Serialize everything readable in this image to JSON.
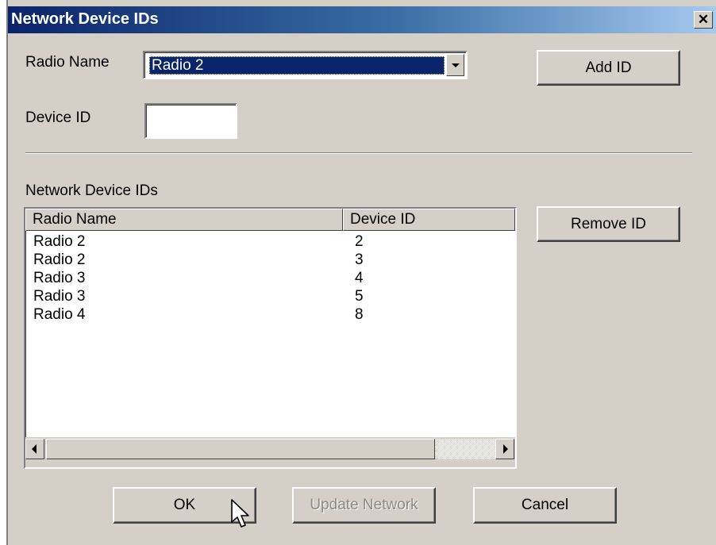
{
  "window": {
    "title": "Network Device IDs",
    "close_glyph": "✕"
  },
  "form": {
    "radio_name_label": "Radio Name",
    "radio_name_value": "Radio 2",
    "device_id_label": "Device ID",
    "device_id_value": "",
    "add_button": "Add ID"
  },
  "list": {
    "section_label": "Network Device IDs",
    "columns": [
      "Radio Name",
      "Device ID"
    ],
    "rows": [
      {
        "name": "Radio 2",
        "id": "2"
      },
      {
        "name": "Radio 2",
        "id": "3"
      },
      {
        "name": "Radio 3",
        "id": "4"
      },
      {
        "name": "Radio 3",
        "id": "5"
      },
      {
        "name": "Radio 4",
        "id": "8"
      }
    ],
    "remove_button": "Remove ID"
  },
  "footer": {
    "ok_button": "OK",
    "update_button": "Update Network",
    "update_enabled": false,
    "cancel_button": "Cancel"
  },
  "icons": {
    "close": "close-icon",
    "dropdown": "chevron-down-icon",
    "scroll_left": "scroll-left-icon",
    "scroll_right": "scroll-right-icon",
    "cursor": "mouse-pointer-icon"
  },
  "colors": {
    "dialog_bg": "#d4d0c8",
    "titlebar_start": "#0a246a",
    "titlebar_end": "#a6caf0",
    "selection": "#0a246a",
    "disabled_text": "#8c8a84"
  }
}
